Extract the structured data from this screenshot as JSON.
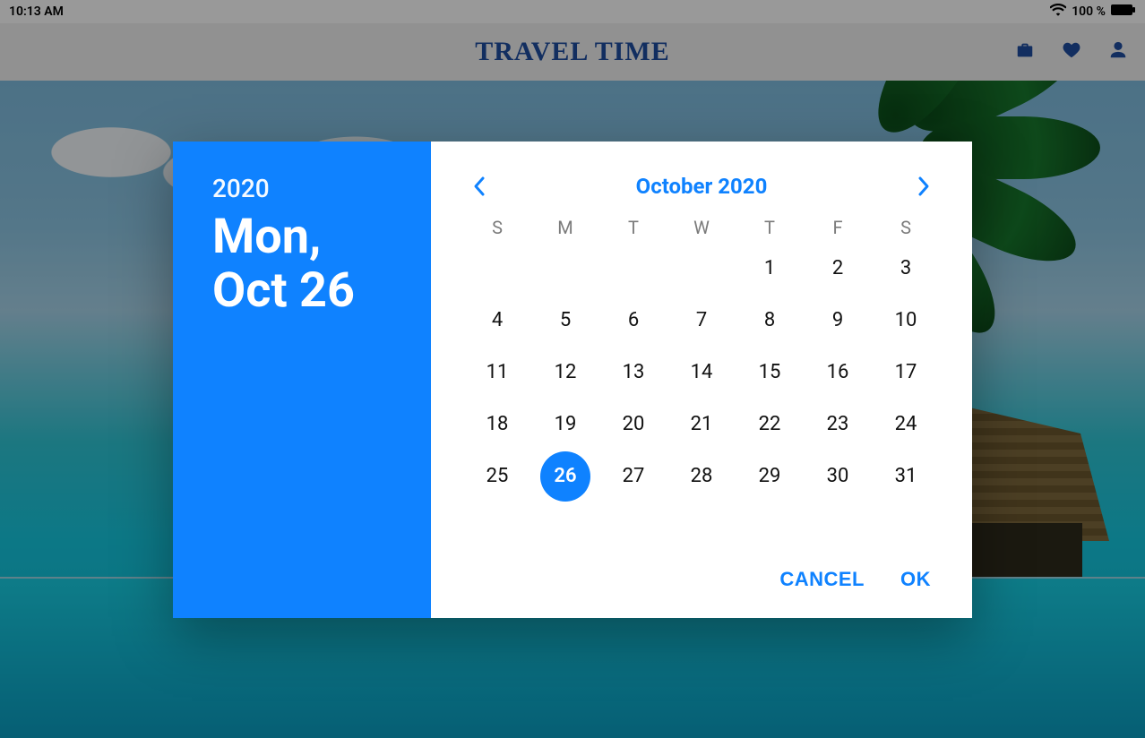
{
  "statusbar": {
    "time": "10:13 AM",
    "battery": "100 %"
  },
  "app": {
    "title": "TRAVEL TIME"
  },
  "picker": {
    "year": "2020",
    "dateLine1": "Mon,",
    "dateLine2": "Oct 26",
    "monthLabel": "October 2020",
    "dow": [
      "S",
      "M",
      "T",
      "W",
      "T",
      "F",
      "S"
    ],
    "leadingBlanks": 4,
    "days": [
      "1",
      "2",
      "3",
      "4",
      "5",
      "6",
      "7",
      "8",
      "9",
      "10",
      "11",
      "12",
      "13",
      "14",
      "15",
      "16",
      "17",
      "18",
      "19",
      "20",
      "21",
      "22",
      "23",
      "24",
      "25",
      "26",
      "27",
      "28",
      "29",
      "30",
      "31"
    ],
    "selected": "26",
    "cancel": "CANCEL",
    "ok": "OK"
  },
  "colors": {
    "accent": "#0f82ff"
  }
}
